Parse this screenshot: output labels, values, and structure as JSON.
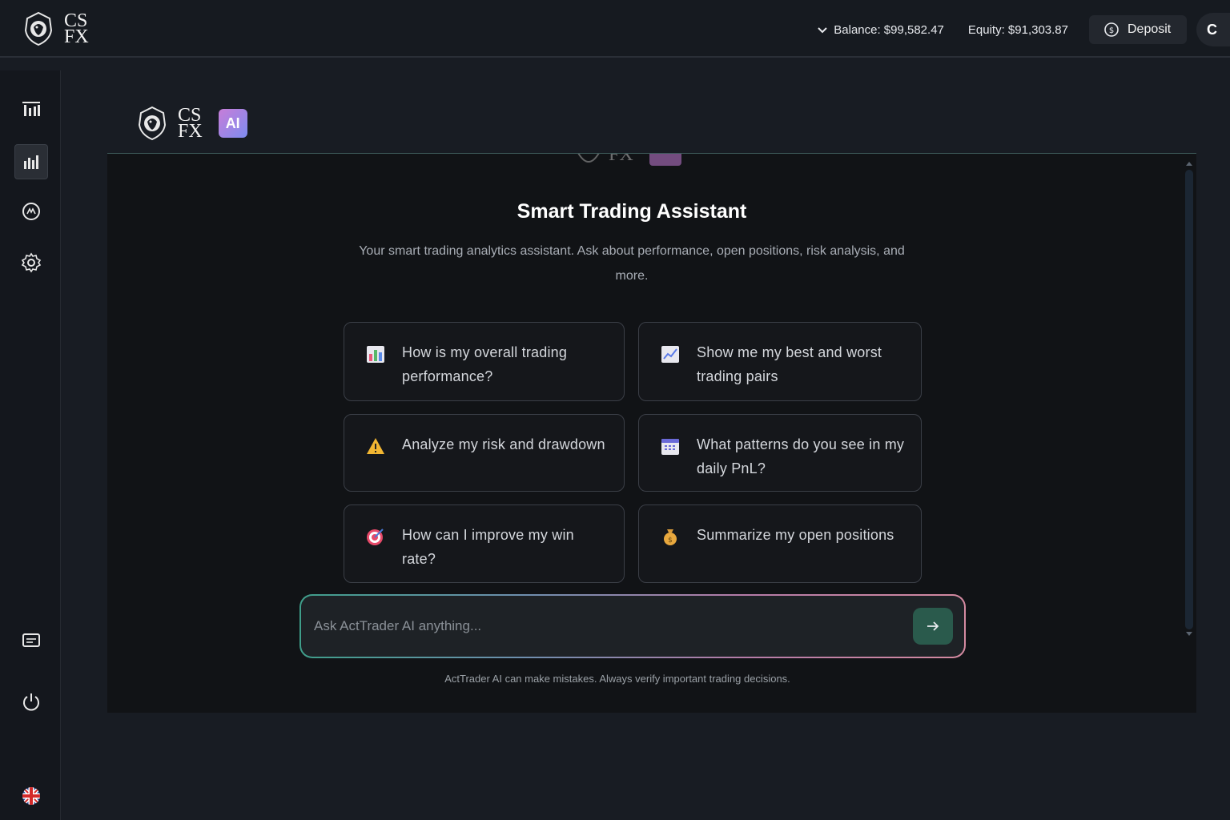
{
  "brand": {
    "line1": "CS",
    "line2": "FX"
  },
  "header": {
    "balance": "Balance: $99,582.47",
    "equity": "Equity: $91,303.87",
    "deposit_label": "Deposit",
    "avatar_initial": "C"
  },
  "sidebar": {
    "items": [
      {
        "name": "dashboard",
        "icon": "bars-chart-icon"
      },
      {
        "name": "analytics",
        "icon": "analytics-chart-icon"
      },
      {
        "name": "market",
        "icon": "gauge-icon"
      },
      {
        "name": "settings",
        "icon": "gear-icon"
      },
      {
        "name": "messages",
        "icon": "message-icon"
      },
      {
        "name": "logout",
        "icon": "power-icon"
      },
      {
        "name": "language",
        "icon": "uk-flag-icon"
      }
    ]
  },
  "assistant": {
    "badge": "AI",
    "title": "Smart Trading Assistant",
    "subtitle": "Your smart trading analytics assistant. Ask about performance, open positions, risk analysis, and more.",
    "suggestions": [
      {
        "icon": "bar-chart-emoji-icon",
        "text": "How is my overall trading performance?"
      },
      {
        "icon": "trend-up-emoji-icon",
        "text": "Show me my best and worst trading pairs"
      },
      {
        "icon": "warning-emoji-icon",
        "text": "Analyze my risk and drawdown"
      },
      {
        "icon": "calendar-emoji-icon",
        "text": "What patterns do you see in my daily PnL?"
      },
      {
        "icon": "target-emoji-icon",
        "text": "How can I improve my win rate?"
      },
      {
        "icon": "money-bag-emoji-icon",
        "text": "Summarize my open positions"
      }
    ],
    "input_placeholder": "Ask ActTrader AI anything...",
    "disclaimer": "ActTrader AI can make mistakes. Always verify important trading decisions."
  },
  "colors": {
    "accent_send": "#2a5a4c",
    "ai_gradient_start": "#c77dd8",
    "ai_gradient_end": "#7d8cf0"
  }
}
